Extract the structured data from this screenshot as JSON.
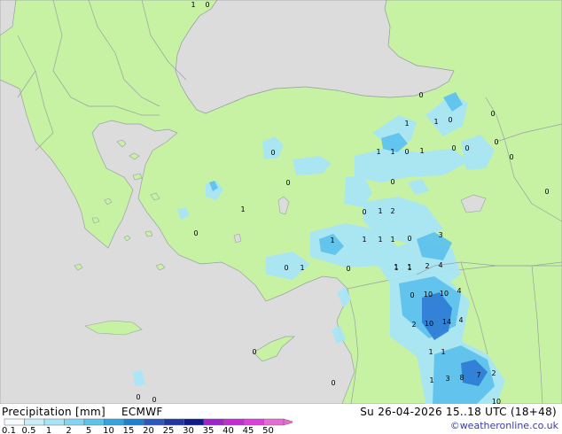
{
  "footer": {
    "title": "Precipitation [mm]",
    "model": "ECMWF",
    "datetime": "Su 26-04-2026 15..18 UTC (18+48)",
    "credit": "©weatheronline.co.uk"
  },
  "legend": {
    "labels": [
      "0.1",
      "0.5",
      "1",
      "2",
      "5",
      "10",
      "15",
      "20",
      "25",
      "30",
      "35",
      "40",
      "45",
      "50"
    ],
    "colors": [
      "#f4fbfd",
      "#c8eefa",
      "#a6e4f7",
      "#7fd6f2",
      "#58c5ea",
      "#2fa6e0",
      "#1a82d2",
      "#2a56c4",
      "#2136a6",
      "#0c1a8e",
      "#a020d2",
      "#c828d8",
      "#e03ce0",
      "#e86ad4"
    ]
  },
  "colors": {
    "land": "#c7f2a3",
    "sea": "#dcdcdc",
    "border": "#9aa0a4",
    "precip_light": "#a9e5f7",
    "precip_medium": "#5fc3ec",
    "precip_heavy": "#2f7fd6"
  },
  "map_values": [
    {
      "text": "1"
    },
    {
      "text": "0"
    },
    {
      "text": "0"
    },
    {
      "text": "1"
    },
    {
      "text": "1"
    },
    {
      "text": "0"
    },
    {
      "text": "0"
    },
    {
      "text": "0"
    },
    {
      "text": "0"
    },
    {
      "text": "1"
    },
    {
      "text": "1"
    },
    {
      "text": "0"
    },
    {
      "text": "1"
    },
    {
      "text": "0"
    },
    {
      "text": "0"
    },
    {
      "text": "0"
    },
    {
      "text": "0"
    },
    {
      "text": "0"
    },
    {
      "text": "0"
    },
    {
      "text": "1"
    },
    {
      "text": "0"
    },
    {
      "text": "1"
    },
    {
      "text": "2"
    },
    {
      "text": "1"
    },
    {
      "text": "1"
    },
    {
      "text": "1"
    },
    {
      "text": "0"
    },
    {
      "text": "1"
    },
    {
      "text": "1"
    },
    {
      "text": "1"
    },
    {
      "text": "0"
    },
    {
      "text": "3"
    },
    {
      "text": "0"
    },
    {
      "text": "1"
    },
    {
      "text": "0"
    },
    {
      "text": "1"
    },
    {
      "text": "1"
    },
    {
      "text": "2"
    },
    {
      "text": "4"
    },
    {
      "text": "0"
    },
    {
      "text": "10"
    },
    {
      "text": "10"
    },
    {
      "text": "4"
    },
    {
      "text": "2"
    },
    {
      "text": "10"
    },
    {
      "text": "14"
    },
    {
      "text": "4"
    },
    {
      "text": "1"
    },
    {
      "text": "1"
    },
    {
      "text": "1"
    },
    {
      "text": "3"
    },
    {
      "text": "8"
    },
    {
      "text": "7"
    },
    {
      "text": "2"
    },
    {
      "text": "10"
    },
    {
      "text": "0"
    },
    {
      "text": "0"
    },
    {
      "text": "0"
    },
    {
      "text": "0"
    }
  ]
}
